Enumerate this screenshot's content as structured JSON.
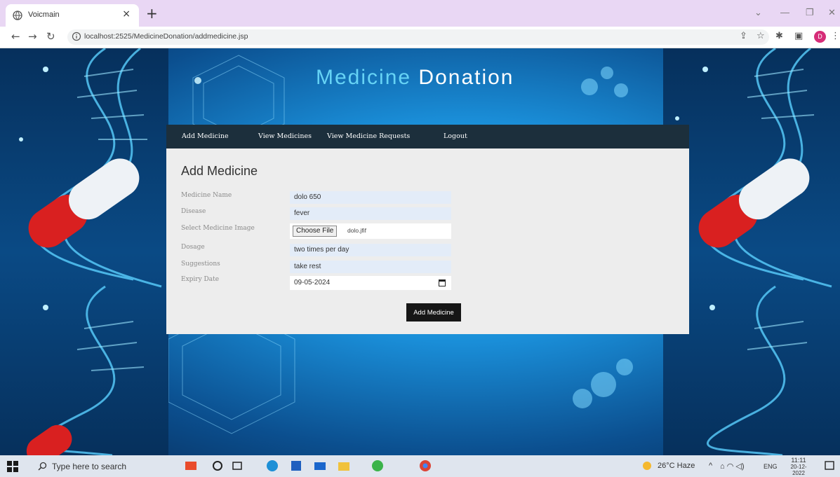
{
  "browser": {
    "tab_title": "Voicmain",
    "url": "localhost:2525/MedicineDonation/addmedicine.jsp",
    "profile_initial": "D"
  },
  "site": {
    "brand_part1": "Medicine",
    "brand_part2": "Donation",
    "nav": [
      "Add Medicine",
      "View Medicines",
      "View Medicine Requests",
      "Logout"
    ]
  },
  "form": {
    "heading": "Add Medicine",
    "fields": {
      "medicine_name": {
        "label": "Medicine Name",
        "value": "dolo 650"
      },
      "disease": {
        "label": "Disease",
        "value": "fever"
      },
      "image": {
        "label": "Select Medicine Image",
        "button": "Choose File",
        "filename": "dolo.jfif"
      },
      "dosage": {
        "label": "Dosage",
        "value": "two times per day"
      },
      "suggestions": {
        "label": "Suggestions",
        "value": "take rest"
      },
      "expiry": {
        "label": "Expiry Date",
        "value": "09-05-2024"
      }
    },
    "submit_label": "Add Medicine"
  },
  "taskbar": {
    "search_placeholder": "Type here to search",
    "weather": "26°C Haze",
    "lang": "ENG",
    "time": "11:11",
    "date": "20-12-2022"
  },
  "colors": {
    "brand_accent": "#66d3f5",
    "navbar": "#1c2f3c",
    "form_bg": "#ededed",
    "submit_bg": "#161616"
  }
}
